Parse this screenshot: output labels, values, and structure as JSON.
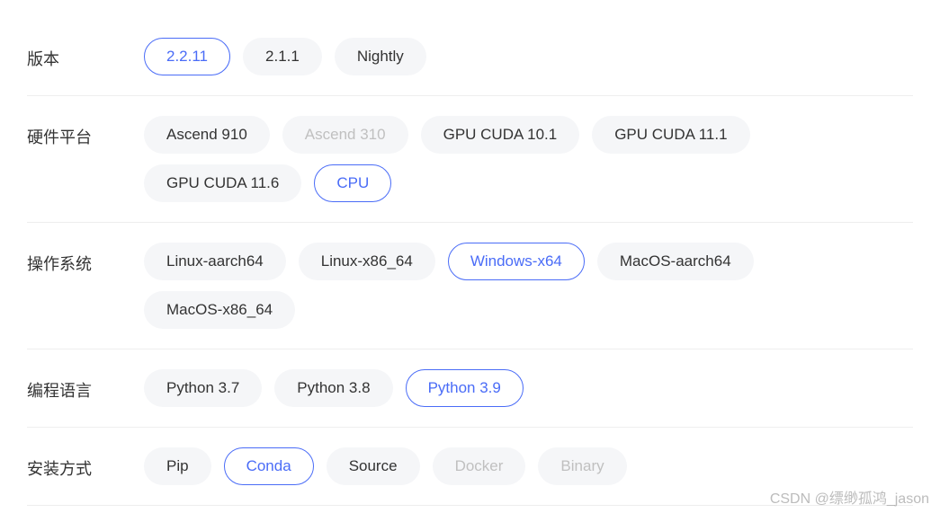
{
  "rows": [
    {
      "label": "版本",
      "name": "version",
      "options": [
        {
          "text": "2.2.11",
          "selected": true,
          "disabled": false,
          "name": "version-2-2-11"
        },
        {
          "text": "2.1.1",
          "selected": false,
          "disabled": false,
          "name": "version-2-1-1"
        },
        {
          "text": "Nightly",
          "selected": false,
          "disabled": false,
          "name": "version-nightly"
        }
      ]
    },
    {
      "label": "硬件平台",
      "name": "hardware",
      "options": [
        {
          "text": "Ascend 910",
          "selected": false,
          "disabled": false,
          "name": "hw-ascend-910"
        },
        {
          "text": "Ascend 310",
          "selected": false,
          "disabled": true,
          "name": "hw-ascend-310"
        },
        {
          "text": "GPU CUDA 10.1",
          "selected": false,
          "disabled": false,
          "name": "hw-cuda-10-1"
        },
        {
          "text": "GPU CUDA 11.1",
          "selected": false,
          "disabled": false,
          "name": "hw-cuda-11-1"
        },
        {
          "text": "GPU CUDA 11.6",
          "selected": false,
          "disabled": false,
          "name": "hw-cuda-11-6"
        },
        {
          "text": "CPU",
          "selected": true,
          "disabled": false,
          "name": "hw-cpu"
        }
      ]
    },
    {
      "label": "操作系统",
      "name": "os",
      "options": [
        {
          "text": "Linux-aarch64",
          "selected": false,
          "disabled": false,
          "name": "os-linux-aarch64"
        },
        {
          "text": "Linux-x86_64",
          "selected": false,
          "disabled": false,
          "name": "os-linux-x86-64"
        },
        {
          "text": "Windows-x64",
          "selected": true,
          "disabled": false,
          "name": "os-windows-x64"
        },
        {
          "text": "MacOS-aarch64",
          "selected": false,
          "disabled": false,
          "name": "os-macos-aarch64"
        },
        {
          "text": "MacOS-x86_64",
          "selected": false,
          "disabled": false,
          "name": "os-macos-x86-64"
        }
      ]
    },
    {
      "label": "编程语言",
      "name": "language",
      "options": [
        {
          "text": "Python 3.7",
          "selected": false,
          "disabled": false,
          "name": "lang-python-3-7"
        },
        {
          "text": "Python 3.8",
          "selected": false,
          "disabled": false,
          "name": "lang-python-3-8"
        },
        {
          "text": "Python 3.9",
          "selected": true,
          "disabled": false,
          "name": "lang-python-3-9"
        }
      ]
    },
    {
      "label": "安装方式",
      "name": "install",
      "options": [
        {
          "text": "Pip",
          "selected": false,
          "disabled": false,
          "name": "install-pip"
        },
        {
          "text": "Conda",
          "selected": true,
          "disabled": false,
          "name": "install-conda"
        },
        {
          "text": "Source",
          "selected": false,
          "disabled": false,
          "name": "install-source"
        },
        {
          "text": "Docker",
          "selected": false,
          "disabled": true,
          "name": "install-docker"
        },
        {
          "text": "Binary",
          "selected": false,
          "disabled": true,
          "name": "install-binary"
        }
      ]
    }
  ],
  "watermark": "CSDN @缥缈孤鸿_jason"
}
